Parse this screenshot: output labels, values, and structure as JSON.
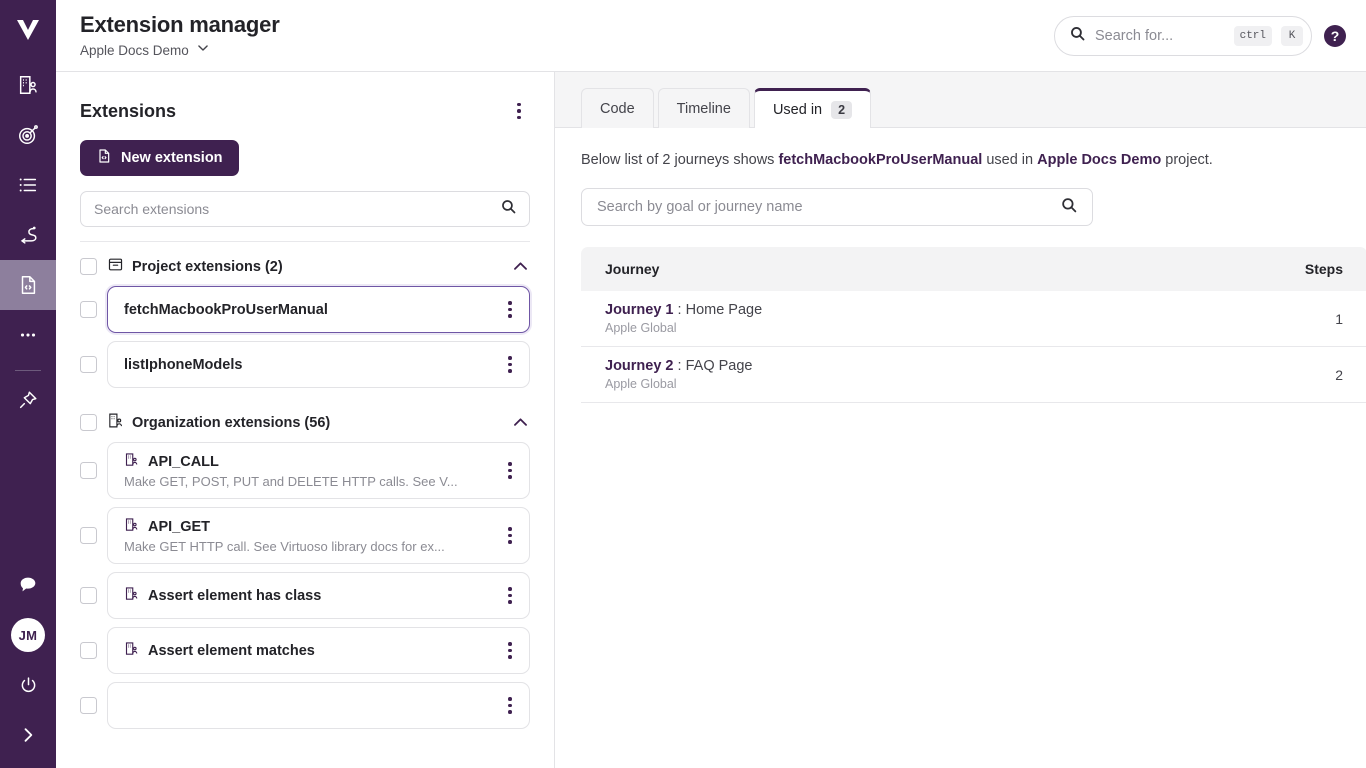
{
  "rail": {
    "logo_icon": "virtuoso-logo-icon",
    "items": [
      {
        "icon": "organization-icon",
        "name": "organization",
        "active": false
      },
      {
        "icon": "goal-target-icon",
        "name": "goals",
        "active": false
      },
      {
        "icon": "list-icon",
        "name": "test-plans",
        "active": false
      },
      {
        "icon": "journey-path-icon",
        "name": "journeys",
        "active": false
      },
      {
        "icon": "code-file-icon",
        "name": "extensions",
        "active": true
      },
      {
        "icon": "more-dots-icon",
        "name": "more",
        "active": false
      },
      {
        "icon": "pin-icon",
        "name": "pinned",
        "active": false
      }
    ],
    "bottom": [
      {
        "icon": "chat-bubble-icon",
        "name": "support-chat"
      },
      {
        "icon": "avatar",
        "name": "user-avatar",
        "initials": "JM"
      },
      {
        "icon": "power-icon",
        "name": "logout"
      },
      {
        "icon": "chevron-right-icon",
        "name": "expand-rail"
      }
    ]
  },
  "header": {
    "title": "Extension manager",
    "project": "Apple Docs Demo",
    "project_chevron_icon": "chevron-down-icon",
    "search": {
      "icon": "search-icon",
      "placeholder": "Search for...",
      "value": "",
      "shortcut_mod": "ctrl",
      "shortcut_key": "K"
    },
    "help_icon": "question-mark-icon",
    "help_label": "?"
  },
  "panel": {
    "title": "Extensions",
    "menu_icon": "kebab-menu-icon",
    "new_button": {
      "label": "New extension",
      "icon": "new-extension-icon"
    },
    "search": {
      "placeholder": "Search extensions",
      "value": "",
      "icon": "search-icon"
    },
    "groups": [
      {
        "label": "Project extensions (2)",
        "icon": "project-box-icon",
        "expanded": true,
        "chevron_icon": "chevron-up-icon",
        "items": [
          {
            "name": "fetchMacbookProUserManual",
            "desc": "",
            "selected": true,
            "icon": ""
          },
          {
            "name": "listIphoneModels",
            "desc": "",
            "selected": false,
            "icon": ""
          }
        ]
      },
      {
        "label": "Organization extensions (56)",
        "icon": "organization-extension-icon",
        "expanded": true,
        "chevron_icon": "chevron-up-icon",
        "items": [
          {
            "name": "API_CALL",
            "desc": "Make GET, POST, PUT and DELETE HTTP calls. See V...",
            "selected": false,
            "icon": "organization-extension-icon"
          },
          {
            "name": "API_GET",
            "desc": "Make GET HTTP call. See Virtuoso library docs for ex...",
            "selected": false,
            "icon": "organization-extension-icon"
          },
          {
            "name": "Assert element has class",
            "desc": "",
            "selected": false,
            "icon": "organization-extension-icon"
          },
          {
            "name": "Assert element matches",
            "desc": "",
            "selected": false,
            "icon": "organization-extension-icon"
          }
        ]
      }
    ]
  },
  "main": {
    "tabs": [
      {
        "label": "Code",
        "badge": "",
        "active": false
      },
      {
        "label": "Timeline",
        "badge": "",
        "active": false
      },
      {
        "label": "Used in",
        "badge": "2",
        "active": true
      }
    ],
    "description": {
      "before": "Below list of 2 journeys shows ",
      "extension": "fetchMacbookProUserManual",
      "middle": " used in ",
      "project": "Apple Docs Demo",
      "after": " project."
    },
    "search": {
      "placeholder": "Search by goal or journey name",
      "value": "",
      "icon": "search-icon"
    },
    "table": {
      "columns": [
        "Journey",
        "Steps"
      ],
      "rows": [
        {
          "journey_bold": "Journey 1",
          "journey_sep": " : ",
          "journey_rest": "Home Page",
          "goal": "Apple Global",
          "steps": "1"
        },
        {
          "journey_bold": "Journey 2",
          "journey_sep": " : ",
          "journey_rest": "FAQ Page",
          "goal": "Apple Global",
          "steps": "2"
        }
      ]
    }
  },
  "colors": {
    "brand_purple": "#3f2150",
    "rail_active": "#8d7f9d",
    "selected_border": "#6f56a5",
    "tab_strip_bg": "#f5f5f6",
    "table_head_bg": "#f3f3f4"
  }
}
